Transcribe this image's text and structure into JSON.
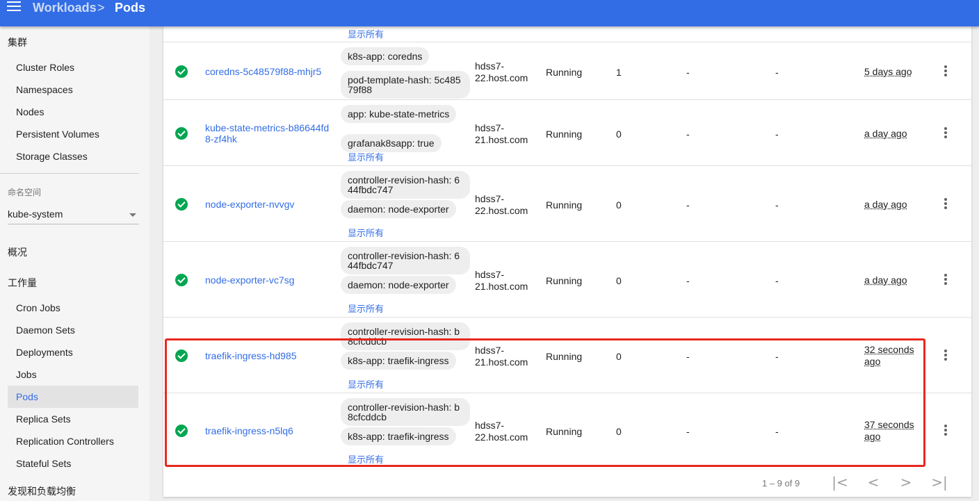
{
  "header": {
    "crumb_parent": "Workloads",
    "crumb_separator": ">",
    "crumb_current": "Pods"
  },
  "sidebar": {
    "cluster_section": "集群",
    "cluster_items": [
      "Cluster Roles",
      "Namespaces",
      "Nodes",
      "Persistent Volumes",
      "Storage Classes"
    ],
    "namespace_label": "命名空间",
    "namespace_value": "kube-system",
    "overview": "概况",
    "workloads_section": "工作量",
    "workload_items": [
      "Cron Jobs",
      "Daemon Sets",
      "Deployments",
      "Jobs",
      "Pods",
      "Replica Sets",
      "Replication Controllers",
      "Stateful Sets"
    ],
    "active_item": "Pods",
    "discovery_section": "发现和负载均衡"
  },
  "show_all_label": "显示所有",
  "partial_row_show_all": "显示所有",
  "pods": [
    {
      "name": "coredns-5c48579f88-mhjr5",
      "labels": [
        "k8s-app: coredns",
        "pod-template-hash: 5c48579f88"
      ],
      "show_all": false,
      "node": "hdss7-22.host.com",
      "status": "Running",
      "restarts": "1",
      "cpu": "-",
      "memory": "-",
      "age": "5 days ago"
    },
    {
      "name": "kube-state-metrics-b86644fd8-zf4hk",
      "labels": [
        "app: kube-state-metrics",
        "grafanak8sapp: true"
      ],
      "show_all": true,
      "node": "hdss7-21.host.com",
      "status": "Running",
      "restarts": "0",
      "cpu": "-",
      "memory": "-",
      "age": "a day ago"
    },
    {
      "name": "node-exporter-nvvgv",
      "labels": [
        "controller-revision-hash: 644fbdc747",
        "daemon: node-exporter"
      ],
      "show_all": true,
      "node": "hdss7-22.host.com",
      "status": "Running",
      "restarts": "0",
      "cpu": "-",
      "memory": "-",
      "age": "a day ago"
    },
    {
      "name": "node-exporter-vc7sg",
      "labels": [
        "controller-revision-hash: 644fbdc747",
        "daemon: node-exporter"
      ],
      "show_all": true,
      "node": "hdss7-21.host.com",
      "status": "Running",
      "restarts": "0",
      "cpu": "-",
      "memory": "-",
      "age": "a day ago"
    },
    {
      "name": "traefik-ingress-hd985",
      "labels": [
        "controller-revision-hash: b8cfcddcb",
        "k8s-app: traefik-ingress"
      ],
      "show_all": true,
      "node": "hdss7-21.host.com",
      "status": "Running",
      "restarts": "0",
      "cpu": "-",
      "memory": "-",
      "age": "32 seconds ago"
    },
    {
      "name": "traefik-ingress-n5lq6",
      "labels": [
        "controller-revision-hash: b8cfcddcb",
        "k8s-app: traefik-ingress"
      ],
      "show_all": true,
      "node": "hdss7-22.host.com",
      "status": "Running",
      "restarts": "0",
      "cpu": "-",
      "memory": "-",
      "age": "37 seconds ago"
    }
  ],
  "pagination": {
    "range": "1 – 9 of 9",
    "first": "|<",
    "prev": "<",
    "next": ">",
    "last": ">|"
  },
  "colors": {
    "accent": "#326de6",
    "status_ok": "#00a651",
    "highlight": "#e8281e"
  }
}
